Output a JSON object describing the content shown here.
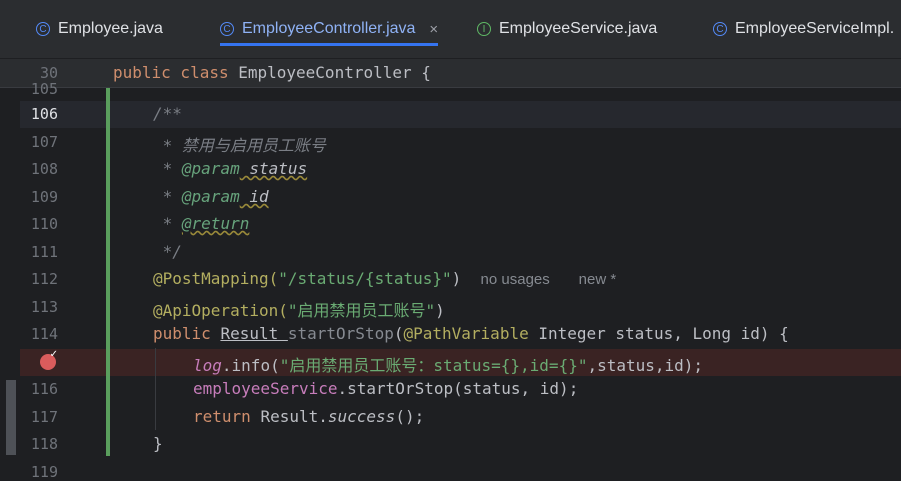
{
  "tabs": [
    {
      "label": "Employee.java",
      "icon": "class-icon",
      "glyph": "C",
      "active": false
    },
    {
      "label": "EmployeeController.java",
      "icon": "class-icon",
      "glyph": "C",
      "active": true,
      "close": "×"
    },
    {
      "label": "EmployeeService.java",
      "icon": "interface-icon",
      "glyph": "I",
      "active": false
    },
    {
      "label": "EmployeeServiceImpl.",
      "icon": "class-icon",
      "glyph": "C",
      "active": false
    }
  ],
  "sticky": {
    "line": "30",
    "kw": "public class",
    "name": "EmployeeController {"
  },
  "lines": {
    "n_partial": "105",
    "n106": "106",
    "n107": "107",
    "n108": "108",
    "n109": "109",
    "n110": "110",
    "n111": "111",
    "n112": "112",
    "n113": "113",
    "n114": "114",
    "n116": "116",
    "n117": "117",
    "n118": "118",
    "n119": "119"
  },
  "code": {
    "l106": "/**",
    "l107": " * 禁用与启用员工账号",
    "l108_star": " * ",
    "l108_tag": "@param",
    "l108_arg": " status",
    "l109_star": " * ",
    "l109_tag": "@param",
    "l109_arg": " id",
    "l110_star": " * ",
    "l110_tag": "@return",
    "l111": " */",
    "l112_ann": "@PostMapping(",
    "l112_str": "\"/status/{status}\"",
    "l112_close": ")",
    "l112_hint1": "no usages",
    "l112_hint2": "new *",
    "l113_ann": "@ApiOperation(",
    "l113_str": "\"启用禁用员工账号\"",
    "l113_close": ")",
    "l114_kw": "public ",
    "l114_type": "Result ",
    "l114_fn": "startOrStop",
    "l114_p1": "(",
    "l114_ann": "@PathVariable",
    "l114_rest": " Integer status, Long id) {",
    "l115_log": "log",
    "l115_info": ".info(",
    "l115_str": "\"启用禁用员工账号：status={},id={}\"",
    "l115_rest": ",status,id);",
    "l116_fld": "employeeService",
    "l116_rest": ".startOrStop(status, id);",
    "l117_kw": "return ",
    "l117_cls": "Result.",
    "l117_fn": "success",
    "l117_rest": "();",
    "l118": "}"
  }
}
